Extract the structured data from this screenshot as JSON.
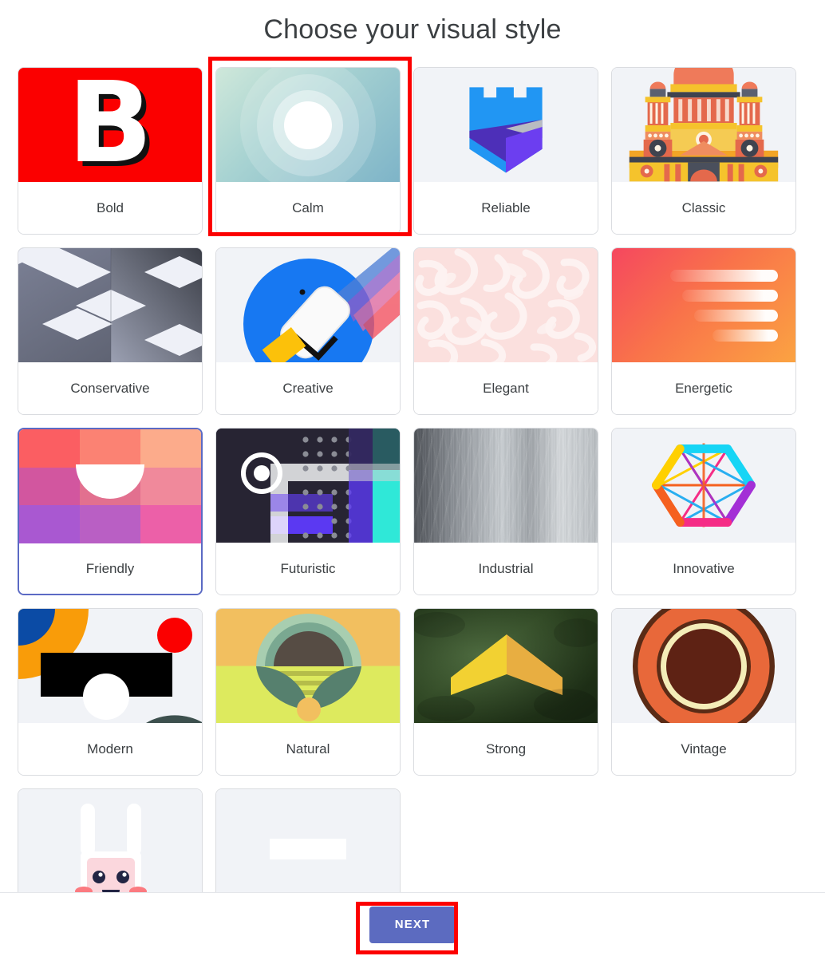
{
  "header": {
    "title": "Choose your visual style"
  },
  "footer": {
    "next_label": "NEXT",
    "next_color": "#5c6bc0"
  },
  "annotations": {
    "highlight_color": "#fc0000",
    "highlighted_elements": [
      "card-calm",
      "next-button"
    ]
  },
  "grid": {
    "columns": 4,
    "hovered_card": "Friendly",
    "hover_border_color": "#5b6ac4",
    "cards": [
      {
        "label": "Bold",
        "art": "bold-letter-art",
        "colors": [
          "#fb0000",
          "#ffffff",
          "#111111"
        ]
      },
      {
        "label": "Calm",
        "art": "concentric-circles-art",
        "colors": [
          "#cfe8da",
          "#a8d3d2",
          "#7eb4c8",
          "#ffffff"
        ]
      },
      {
        "label": "Reliable",
        "art": "castle-shield-art",
        "colors": [
          "#2196f3",
          "#4d2fb8",
          "#6c3ef0",
          "#b9bcc1"
        ]
      },
      {
        "label": "Classic",
        "art": "classical-building-art",
        "colors": [
          "#ef7a5a",
          "#f5c32c",
          "#f0932b",
          "#4a4f5c"
        ]
      },
      {
        "label": "Conservative",
        "art": "isometric-cube-art",
        "colors": [
          "#6e7388",
          "#eef0f7",
          "#3c3f49"
        ]
      },
      {
        "label": "Creative",
        "art": "paint-roller-art",
        "colors": [
          "#1778f2",
          "#ffffff",
          "#fcc10a",
          "#f5515f"
        ]
      },
      {
        "label": "Elegant",
        "art": "damask-pattern-art",
        "colors": [
          "#fbe3e2",
          "#fdf2f1"
        ]
      },
      {
        "label": "Energetic",
        "art": "speed-bars-art",
        "colors": [
          "#f5475f",
          "#f9734a",
          "#fba342",
          "#ffffff"
        ]
      },
      {
        "label": "Friendly",
        "art": "color-grid-smile-art",
        "colors": [
          "#fb5e62",
          "#d2569f",
          "#a958d1",
          "#ffffff"
        ]
      },
      {
        "label": "Futuristic",
        "art": "tech-circuit-art",
        "colors": [
          "#272433",
          "#5b39d6",
          "#2fe8d8",
          "#ffffff"
        ]
      },
      {
        "label": "Industrial",
        "art": "brushed-metal-art",
        "colors": [
          "#4b4f55",
          "#c7ccd0",
          "#d5d9dc"
        ]
      },
      {
        "label": "Innovative",
        "art": "hexagon-network-art",
        "colors": [
          "#16d5f5",
          "#ffd000",
          "#f5601f",
          "#f52c86",
          "#a32fd6"
        ]
      },
      {
        "label": "Modern",
        "art": "bauhaus-shapes-art",
        "colors": [
          "#0b4ba5",
          "#f99c09",
          "#fb0000",
          "#000000",
          "#3d504e"
        ]
      },
      {
        "label": "Natural",
        "art": "sunset-leaves-art",
        "colors": [
          "#f2bf5f",
          "#ddea5e",
          "#a8ceb0",
          "#56806e",
          "#564c44"
        ]
      },
      {
        "label": "Strong",
        "art": "chevron-grunge-art",
        "colors": [
          "#2e4a22",
          "#f2d132",
          "#e8ae41"
        ]
      },
      {
        "label": "Vintage",
        "art": "concentric-rings-art",
        "colors": [
          "#5a2b16",
          "#e8683a",
          "#f4edb8"
        ]
      },
      {
        "label": "",
        "art": "bunny-face-art",
        "colors": [
          "#ffffff",
          "#fbd7dd",
          "#232544",
          "#fb7a80"
        ]
      },
      {
        "label": "",
        "art": "blank-bar-art",
        "colors": [
          "#f1f3f7",
          "#ffffff"
        ]
      }
    ]
  }
}
